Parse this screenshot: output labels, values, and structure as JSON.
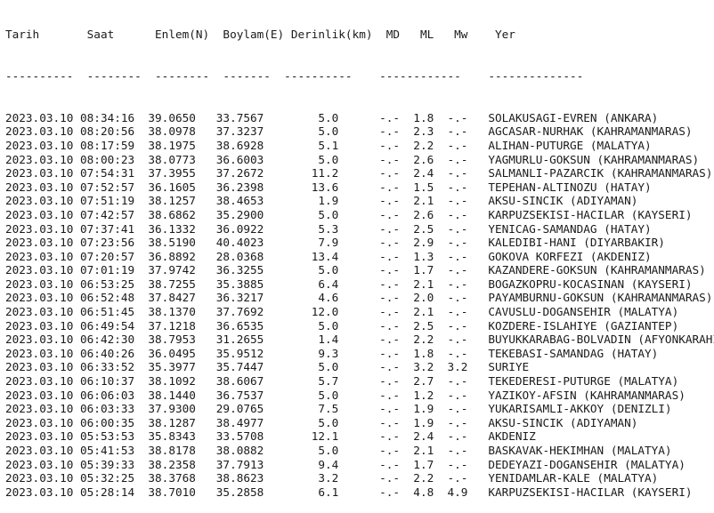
{
  "header": {
    "line": "Tarih       Saat      Enlem(N)  Boylam(E) Derinlik(km)  MD   ML   Mw    Yer",
    "separator": "----------  --------  --------  -------  ----------    ------------    --------------"
  },
  "columns": [
    "Tarih",
    "Saat",
    "Enlem(N)",
    "Boylam(E)",
    "Derinlik(km)",
    "MD",
    "ML",
    "Mw",
    "Yer"
  ],
  "rows": [
    "2023.03.10 08:34:16  39.0650   33.7567        5.0      -.-  1.8  -.-   SOLAKUSAGI-EVREN (ANKARA)",
    "2023.03.10 08:20:56  38.0978   37.3237        5.0      -.-  2.3  -.-   AGCASAR-NURHAK (KAHRAMANMARAS)",
    "2023.03.10 08:17:59  38.1975   38.6928        5.1      -.-  2.2  -.-   ALIHAN-PUTURGE (MALATYA)",
    "2023.03.10 08:00:23  38.0773   36.6003        5.0      -.-  2.6  -.-   YAGMURLU-GOKSUN (KAHRAMANMARAS)",
    "2023.03.10 07:54:31  37.3955   37.2672       11.2      -.-  2.4  -.-   SALMANLI-PAZARCIK (KAHRAMANMARAS)",
    "2023.03.10 07:52:57  36.1605   36.2398       13.6      -.-  1.5  -.-   TEPEHAN-ALTINOZU (HATAY)",
    "2023.03.10 07:51:19  38.1257   38.4653        1.9      -.-  2.1  -.-   AKSU-SINCIK (ADIYAMAN)",
    "2023.03.10 07:42:57  38.6862   35.2900        5.0      -.-  2.6  -.-   KARPUZSEKISI-HACILAR (KAYSERI)",
    "2023.03.10 07:37:41  36.1332   36.0922        5.3      -.-  2.5  -.-   YENICAG-SAMANDAG (HATAY)",
    "2023.03.10 07:23:56  38.5190   40.4023        7.9      -.-  2.9  -.-   KALEDIBI-HANI (DIYARBAKIR)",
    "2023.03.10 07:20:57  36.8892   28.0368       13.4      -.-  1.3  -.-   GOKOVA KORFEZI (AKDENIZ)",
    "2023.03.10 07:01:19  37.9742   36.3255        5.0      -.-  1.7  -.-   KAZANDERE-GOKSUN (KAHRAMANMARAS)",
    "2023.03.10 06:53:25  38.7255   35.3885        6.4      -.-  2.1  -.-   BOGAZKOPRU-KOCASINAN (KAYSERI)",
    "2023.03.10 06:52:48  37.8427   36.3217        4.6      -.-  2.0  -.-   PAYAMBURNU-GOKSUN (KAHRAMANMARAS)",
    "2023.03.10 06:51:45  38.1370   37.7692       12.0      -.-  2.1  -.-   CAVUSLU-DOGANSEHIR (MALATYA)",
    "2023.03.10 06:49:54  37.1218   36.6535        5.0      -.-  2.5  -.-   KOZDERE-ISLAHIYE (GAZIANTEP)",
    "2023.03.10 06:42:30  38.7953   31.2655        1.4      -.-  2.2  -.-   BUYUKKARABAG-BOLVADIN (AFYONKARAHISAR)",
    "2023.03.10 06:40:26  36.0495   35.9512        9.3      -.-  1.8  -.-   TEKEBASI-SAMANDAG (HATAY)",
    "2023.03.10 06:33:52  35.3977   35.7447        5.0      -.-  3.2  3.2   SURIYE",
    "2023.03.10 06:10:37  38.1092   38.6067        5.7      -.-  2.7  -.-   TEKEDERESI-PUTURGE (MALATYA)",
    "2023.03.10 06:06:03  38.1440   36.7537        5.0      -.-  1.2  -.-   YAZIKOY-AFSIN (KAHRAMANMARAS)",
    "2023.03.10 06:03:33  37.9300   29.0765        7.5      -.-  1.9  -.-   YUKARISAMLI-AKKOY (DENIZLI)",
    "2023.03.10 06:00:35  38.1287   38.4977        5.0      -.-  1.9  -.-   AKSU-SINCIK (ADIYAMAN)",
    "2023.03.10 05:53:53  35.8343   33.5708       12.1      -.-  2.4  -.-   AKDENIZ",
    "2023.03.10 05:41:53  38.8178   38.0882        5.0      -.-  2.1  -.-   BASKAVAK-HEKIMHAN (MALATYA)",
    "2023.03.10 05:39:33  38.2358   37.7913        9.4      -.-  1.7  -.-   DEDEYAZI-DOGANSEHIR (MALATYA)",
    "2023.03.10 05:32:25  38.3768   38.8623        3.2      -.-  2.2  -.-   YENIDAMLAR-KALE (MALATYA)",
    "2023.03.10 05:28:14  38.7010   35.2858        6.1      -.-  4.8  4.9   KARPUZSEKISI-HACILAR (KAYSERI)"
  ]
}
